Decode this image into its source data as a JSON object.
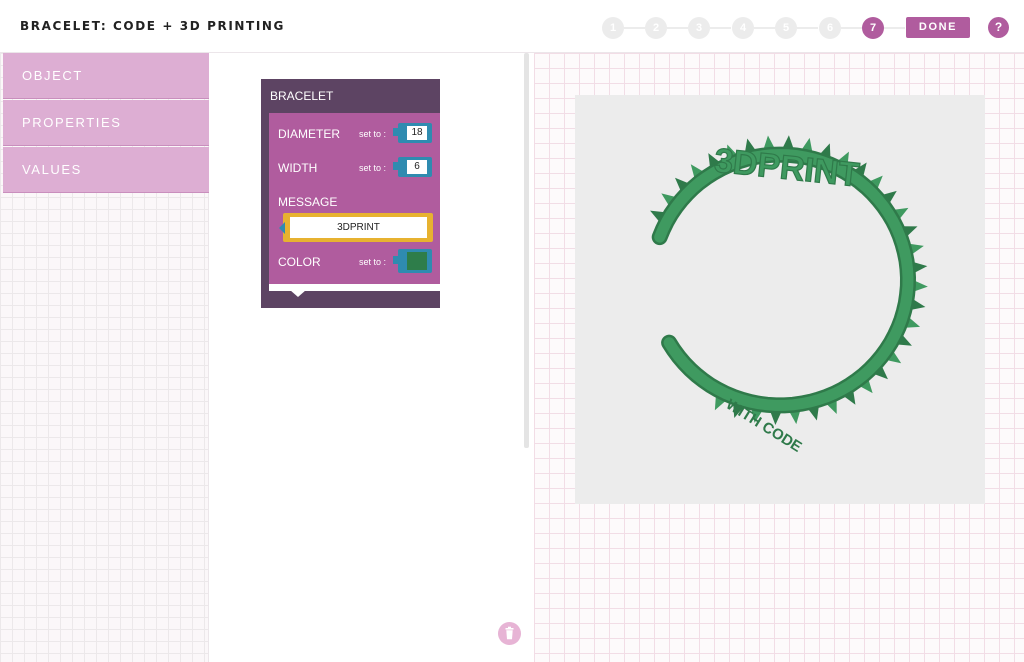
{
  "header": {
    "title": "BRACELET: CODE + 3D PRINTING",
    "steps": [
      "1",
      "2",
      "3",
      "4",
      "5",
      "6",
      "7"
    ],
    "active_step": "7",
    "done_label": "DONE",
    "help_label": "?"
  },
  "sidebar": {
    "categories": [
      {
        "label": "OBJECT"
      },
      {
        "label": "PROPERTIES"
      },
      {
        "label": "VALUES"
      }
    ]
  },
  "block": {
    "title": "BRACELET",
    "diameter_label": "DIAMETER",
    "diameter_setto": "set to :",
    "diameter_value": "18",
    "width_label": "WIDTH",
    "width_setto": "set to :",
    "width_value": "6",
    "message_label": "MESSAGE",
    "message_value": "3DPRINT",
    "color_label": "COLOR",
    "color_setto": "set to :",
    "color_value": "#2e7d4a"
  },
  "preview": {
    "bracelet_text": "3DPRINT",
    "inner_text": "WITH CODE",
    "bracelet_color": "#3f9a60"
  },
  "icons": {
    "trash": "trash-icon"
  },
  "colors": {
    "accent": "#b05c9e",
    "block_dark": "#5d4463",
    "block_body": "#b05c9e",
    "socket": "#2f8bb0",
    "message_outline": "#e7b230"
  }
}
